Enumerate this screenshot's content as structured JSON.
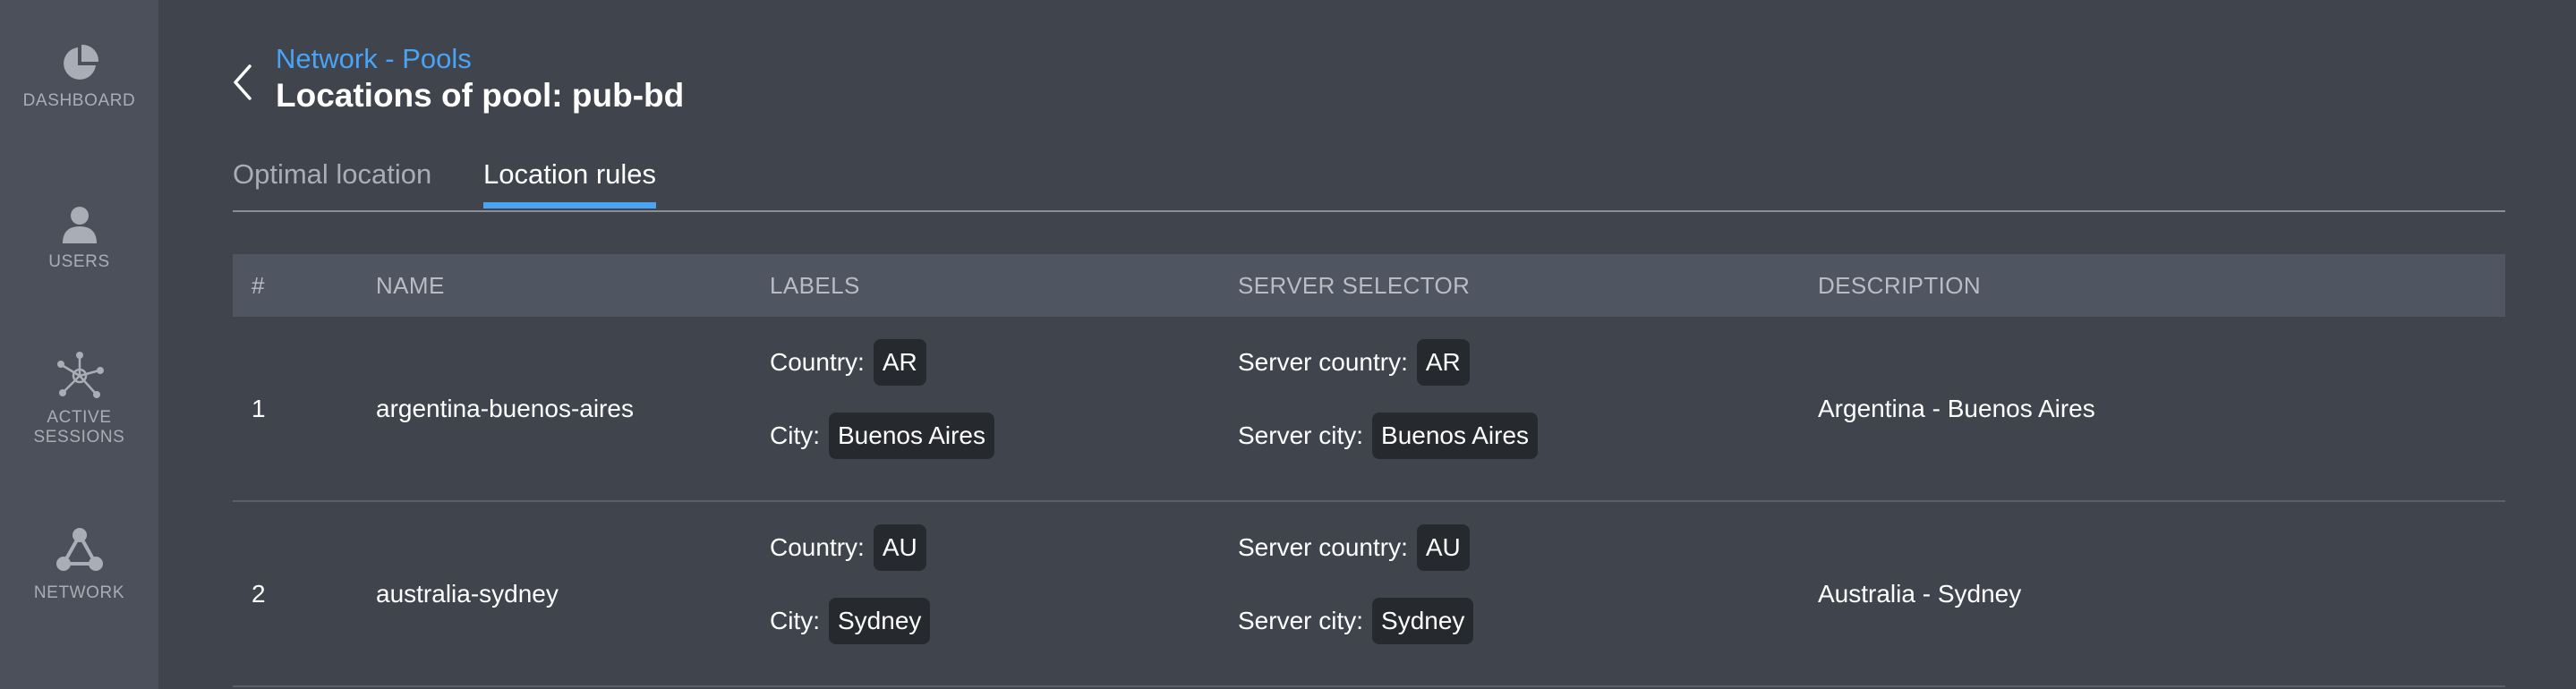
{
  "sidebar": {
    "items": [
      {
        "label": "DASHBOARD",
        "icon": "dashboard-pie-icon"
      },
      {
        "label": "USERS",
        "icon": "user-icon"
      },
      {
        "label": "ACTIVE\nSESSIONS",
        "icon": "network-nodes-icon"
      },
      {
        "label": "NETWORK",
        "icon": "network-triangle-icon"
      }
    ]
  },
  "header": {
    "breadcrumb": "Network - Pools",
    "title": "Locations of pool: pub-bd"
  },
  "tabs": [
    {
      "label": "Optimal location",
      "active": false
    },
    {
      "label": "Location rules",
      "active": true
    }
  ],
  "table": {
    "columns": [
      "#",
      "NAME",
      "LABELS",
      "SERVER SELECTOR",
      "DESCRIPTION"
    ],
    "rows": [
      {
        "num": "1",
        "name": "argentina-buenos-aires",
        "labels": {
          "country_key": "Country:",
          "country": "AR",
          "city_key": "City:",
          "city": "Buenos Aires"
        },
        "server": {
          "country_key": "Server country:",
          "country": "AR",
          "city_key": "Server city:",
          "city": "Buenos Aires"
        },
        "description": "Argentina - Buenos Aires"
      },
      {
        "num": "2",
        "name": "australia-sydney",
        "labels": {
          "country_key": "Country:",
          "country": "AU",
          "city_key": "City:",
          "city": "Sydney"
        },
        "server": {
          "country_key": "Server country:",
          "country": "AU",
          "city_key": "Server city:",
          "city": "Sydney"
        },
        "description": "Australia - Sydney"
      }
    ]
  },
  "colors": {
    "accent": "#4aa3f5",
    "background": "#3f444d",
    "sidebar": "#4b505a",
    "header_row": "#4f5561",
    "chip": "#26292e"
  }
}
